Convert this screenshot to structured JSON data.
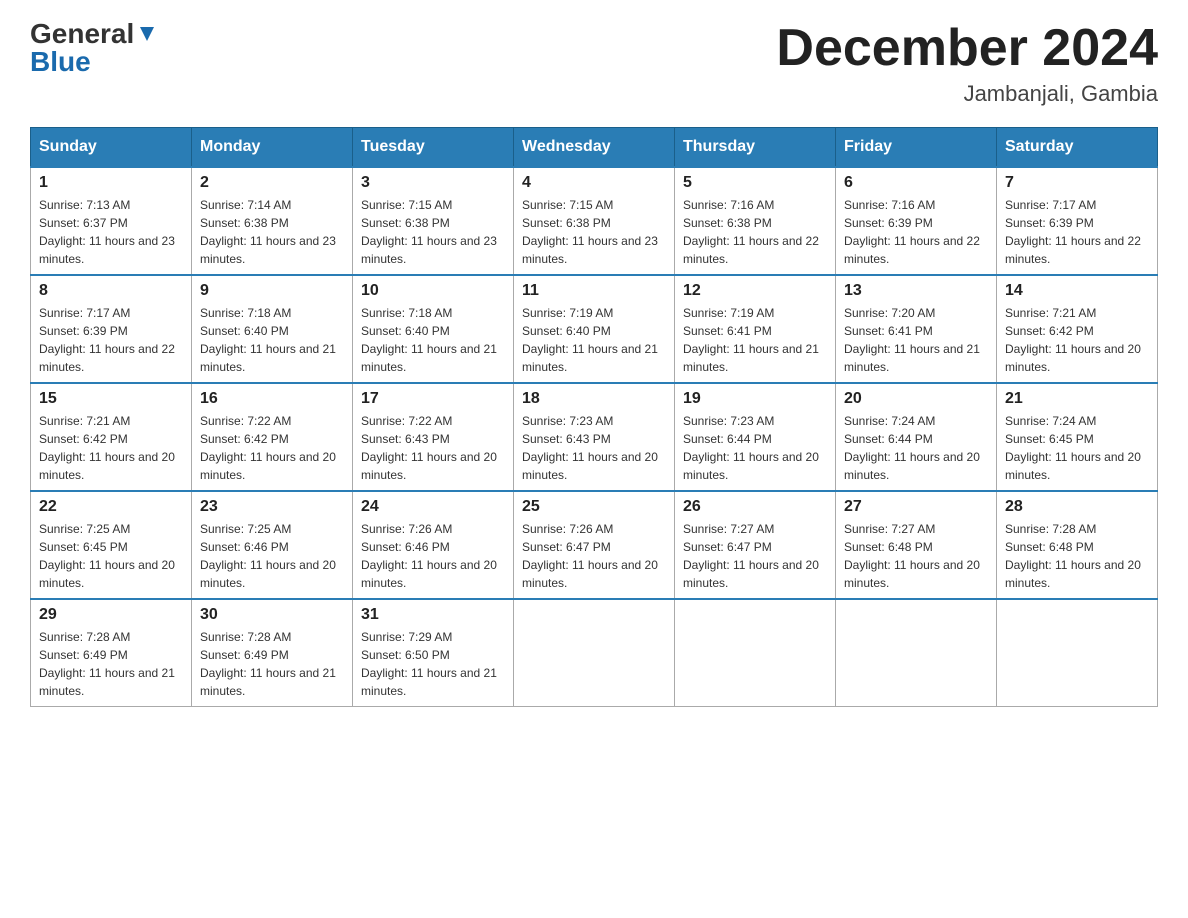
{
  "header": {
    "logo_general": "General",
    "logo_blue": "Blue",
    "month": "December 2024",
    "location": "Jambanjali, Gambia"
  },
  "weekdays": [
    "Sunday",
    "Monday",
    "Tuesday",
    "Wednesday",
    "Thursday",
    "Friday",
    "Saturday"
  ],
  "weeks": [
    [
      {
        "day": "1",
        "sunrise": "7:13 AM",
        "sunset": "6:37 PM",
        "daylight": "11 hours and 23 minutes."
      },
      {
        "day": "2",
        "sunrise": "7:14 AM",
        "sunset": "6:38 PM",
        "daylight": "11 hours and 23 minutes."
      },
      {
        "day": "3",
        "sunrise": "7:15 AM",
        "sunset": "6:38 PM",
        "daylight": "11 hours and 23 minutes."
      },
      {
        "day": "4",
        "sunrise": "7:15 AM",
        "sunset": "6:38 PM",
        "daylight": "11 hours and 23 minutes."
      },
      {
        "day": "5",
        "sunrise": "7:16 AM",
        "sunset": "6:38 PM",
        "daylight": "11 hours and 22 minutes."
      },
      {
        "day": "6",
        "sunrise": "7:16 AM",
        "sunset": "6:39 PM",
        "daylight": "11 hours and 22 minutes."
      },
      {
        "day": "7",
        "sunrise": "7:17 AM",
        "sunset": "6:39 PM",
        "daylight": "11 hours and 22 minutes."
      }
    ],
    [
      {
        "day": "8",
        "sunrise": "7:17 AM",
        "sunset": "6:39 PM",
        "daylight": "11 hours and 22 minutes."
      },
      {
        "day": "9",
        "sunrise": "7:18 AM",
        "sunset": "6:40 PM",
        "daylight": "11 hours and 21 minutes."
      },
      {
        "day": "10",
        "sunrise": "7:18 AM",
        "sunset": "6:40 PM",
        "daylight": "11 hours and 21 minutes."
      },
      {
        "day": "11",
        "sunrise": "7:19 AM",
        "sunset": "6:40 PM",
        "daylight": "11 hours and 21 minutes."
      },
      {
        "day": "12",
        "sunrise": "7:19 AM",
        "sunset": "6:41 PM",
        "daylight": "11 hours and 21 minutes."
      },
      {
        "day": "13",
        "sunrise": "7:20 AM",
        "sunset": "6:41 PM",
        "daylight": "11 hours and 21 minutes."
      },
      {
        "day": "14",
        "sunrise": "7:21 AM",
        "sunset": "6:42 PM",
        "daylight": "11 hours and 20 minutes."
      }
    ],
    [
      {
        "day": "15",
        "sunrise": "7:21 AM",
        "sunset": "6:42 PM",
        "daylight": "11 hours and 20 minutes."
      },
      {
        "day": "16",
        "sunrise": "7:22 AM",
        "sunset": "6:42 PM",
        "daylight": "11 hours and 20 minutes."
      },
      {
        "day": "17",
        "sunrise": "7:22 AM",
        "sunset": "6:43 PM",
        "daylight": "11 hours and 20 minutes."
      },
      {
        "day": "18",
        "sunrise": "7:23 AM",
        "sunset": "6:43 PM",
        "daylight": "11 hours and 20 minutes."
      },
      {
        "day": "19",
        "sunrise": "7:23 AM",
        "sunset": "6:44 PM",
        "daylight": "11 hours and 20 minutes."
      },
      {
        "day": "20",
        "sunrise": "7:24 AM",
        "sunset": "6:44 PM",
        "daylight": "11 hours and 20 minutes."
      },
      {
        "day": "21",
        "sunrise": "7:24 AM",
        "sunset": "6:45 PM",
        "daylight": "11 hours and 20 minutes."
      }
    ],
    [
      {
        "day": "22",
        "sunrise": "7:25 AM",
        "sunset": "6:45 PM",
        "daylight": "11 hours and 20 minutes."
      },
      {
        "day": "23",
        "sunrise": "7:25 AM",
        "sunset": "6:46 PM",
        "daylight": "11 hours and 20 minutes."
      },
      {
        "day": "24",
        "sunrise": "7:26 AM",
        "sunset": "6:46 PM",
        "daylight": "11 hours and 20 minutes."
      },
      {
        "day": "25",
        "sunrise": "7:26 AM",
        "sunset": "6:47 PM",
        "daylight": "11 hours and 20 minutes."
      },
      {
        "day": "26",
        "sunrise": "7:27 AM",
        "sunset": "6:47 PM",
        "daylight": "11 hours and 20 minutes."
      },
      {
        "day": "27",
        "sunrise": "7:27 AM",
        "sunset": "6:48 PM",
        "daylight": "11 hours and 20 minutes."
      },
      {
        "day": "28",
        "sunrise": "7:28 AM",
        "sunset": "6:48 PM",
        "daylight": "11 hours and 20 minutes."
      }
    ],
    [
      {
        "day": "29",
        "sunrise": "7:28 AM",
        "sunset": "6:49 PM",
        "daylight": "11 hours and 21 minutes."
      },
      {
        "day": "30",
        "sunrise": "7:28 AM",
        "sunset": "6:49 PM",
        "daylight": "11 hours and 21 minutes."
      },
      {
        "day": "31",
        "sunrise": "7:29 AM",
        "sunset": "6:50 PM",
        "daylight": "11 hours and 21 minutes."
      },
      null,
      null,
      null,
      null
    ]
  ]
}
